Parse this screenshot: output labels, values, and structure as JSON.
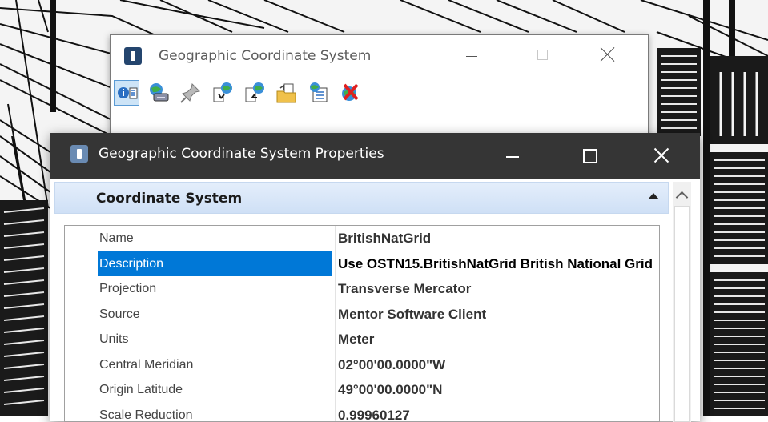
{
  "background": {
    "description_icon": "cad-drawing"
  },
  "gcs_window": {
    "title": "Geographic Coordinate System",
    "toolbar": [
      {
        "icon": "info-list-icon"
      },
      {
        "icon": "globe-disk-icon"
      },
      {
        "icon": "pushpin-icon"
      },
      {
        "icon": "globe-export-icon"
      },
      {
        "icon": "globe-import-icon"
      },
      {
        "icon": "folder-open-icon"
      },
      {
        "icon": "globe-list-icon"
      },
      {
        "icon": "globe-delete-icon"
      }
    ]
  },
  "props_window": {
    "title": "Geographic Coordinate System Properties",
    "section": {
      "title": "Coordinate System"
    },
    "rows": [
      {
        "name": "Name",
        "value": "BritishNatGrid"
      },
      {
        "name": "Description",
        "value": "Use OSTN15.BritishNatGrid British National Grid",
        "selected": true
      },
      {
        "name": "Projection",
        "value": "Transverse Mercator"
      },
      {
        "name": "Source",
        "value": "Mentor Software Client"
      },
      {
        "name": "Units",
        "value": "Meter"
      },
      {
        "name": "Central Meridian",
        "value": "02°00'00.0000\"W"
      },
      {
        "name": "Origin Latitude",
        "value": "49°00'00.0000\"N"
      },
      {
        "name": "Scale Reduction",
        "value": "0.99960127"
      }
    ]
  },
  "colors": {
    "accent": "#0078d7",
    "titlebar_dark": "#353535",
    "section_bg": "#dbe7f8"
  }
}
